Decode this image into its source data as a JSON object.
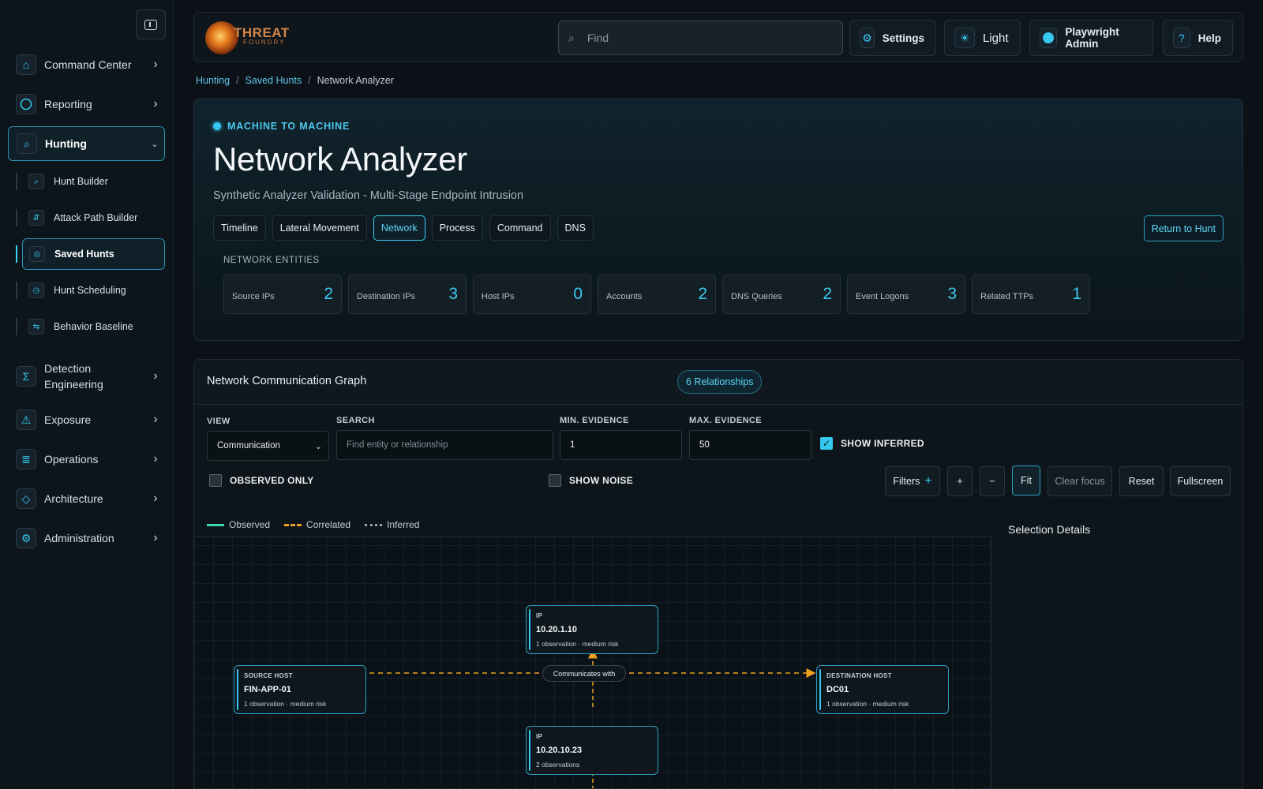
{
  "sidebar": {
    "items": [
      {
        "label": "Command Center",
        "icon": "home-icon"
      },
      {
        "label": "Reporting",
        "icon": "circle-icon"
      },
      {
        "label": "Hunting",
        "icon": "search-icon"
      },
      {
        "label": "Detection Engineering",
        "icon": "sigma-icon"
      },
      {
        "label": "Exposure",
        "icon": "warning-icon"
      },
      {
        "label": "Operations",
        "icon": "list-icon"
      },
      {
        "label": "Architecture",
        "icon": "diamond-icon"
      },
      {
        "label": "Administration",
        "icon": "gear-icon"
      }
    ],
    "hunting_sub": [
      {
        "label": "Hunt Builder",
        "icon": "search-icon"
      },
      {
        "label": "Attack Path Builder",
        "icon": "path-icon"
      },
      {
        "label": "Saved Hunts",
        "icon": "target-icon"
      },
      {
        "label": "Hunt Scheduling",
        "icon": "clock-icon"
      },
      {
        "label": "Behavior Baseline",
        "icon": "swap-icon"
      }
    ]
  },
  "header": {
    "logo_line1": "THREAT",
    "logo_line2": "FOUNDRY",
    "search_placeholder": "Find",
    "settings_label": "Settings",
    "theme_label": "Light",
    "user_label": "Playwright Admin",
    "help_label": "Help"
  },
  "breadcrumb": {
    "items": [
      "Hunting",
      "Saved Hunts",
      "Network Analyzer"
    ],
    "separator": "/"
  },
  "hero": {
    "eyebrow": "MACHINE TO MACHINE",
    "title": "Network Analyzer",
    "subtitle": "Synthetic Analyzer Validation - Multi-Stage Endpoint Intrusion",
    "tabs": [
      "Timeline",
      "Lateral Movement",
      "Network",
      "Process",
      "Command",
      "DNS"
    ],
    "active_tab": "Network",
    "return_label": "Return to Hunt",
    "entities_title": "NETWORK ENTITIES",
    "stats": [
      {
        "label": "Source IPs",
        "value": "2"
      },
      {
        "label": "Destination IPs",
        "value": "3"
      },
      {
        "label": "Host IPs",
        "value": "0"
      },
      {
        "label": "Accounts",
        "value": "2"
      },
      {
        "label": "DNS Queries",
        "value": "2"
      },
      {
        "label": "Event Logons",
        "value": "3"
      },
      {
        "label": "Related TTPs",
        "value": "1"
      }
    ]
  },
  "graph": {
    "title": "Network Communication Graph",
    "relationships_badge": "6 Relationships",
    "view_label": "VIEW",
    "view_value": "Communication",
    "search_label": "SEARCH",
    "search_placeholder": "Find entity or relationship",
    "min_label": "MIN. EVIDENCE",
    "min_value": "1",
    "max_label": "MAX. EVIDENCE",
    "max_value": "50",
    "show_inferred_label": "SHOW INFERRED",
    "show_inferred_checked": true,
    "observed_only_label": "OBSERVED ONLY",
    "observed_only_checked": false,
    "show_noise_label": "SHOW NOISE",
    "show_noise_checked": false,
    "buttons": {
      "filters": "Filters",
      "zoom_in": "+",
      "zoom_out": "−",
      "fit": "Fit",
      "clear_focus": "Clear focus",
      "reset": "Reset",
      "fullscreen": "Fullscreen"
    },
    "legend": [
      {
        "label": "Observed",
        "color": "#3ddcb0",
        "style": "solid"
      },
      {
        "label": "Correlated",
        "color": "#f0a020",
        "style": "dashed"
      },
      {
        "label": "Inferred",
        "color": "#9aa6ae",
        "style": "dotted"
      }
    ],
    "details_title": "Selection Details",
    "edge_label": "Communicates with",
    "nodes": [
      {
        "type": "IP",
        "name": "10.20.1.10",
        "meta": "1 observation · medium risk"
      },
      {
        "type": "SOURCE HOST",
        "name": "FIN-APP-01",
        "meta": "1 observation · medium risk"
      },
      {
        "type": "DESTINATION HOST",
        "name": "DC01",
        "meta": "1 observation · medium risk"
      },
      {
        "type": "IP",
        "name": "10.20.10.23",
        "meta": "2 observations"
      }
    ]
  },
  "colors": {
    "accent": "#36c8ef",
    "correlated_edge": "#f0a020",
    "background": "#0b1116"
  }
}
